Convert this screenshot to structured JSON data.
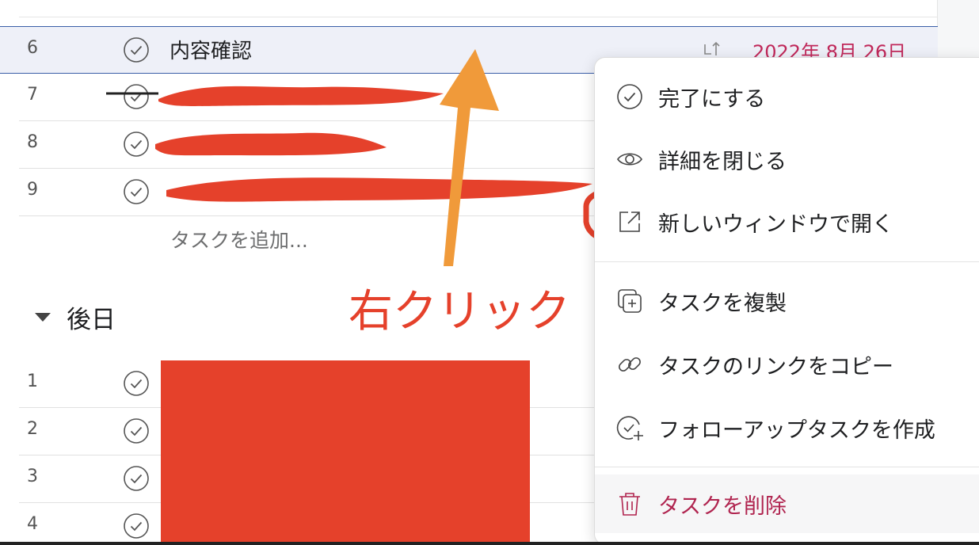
{
  "topsection": {
    "label": ""
  },
  "tasks": [
    {
      "num": "6",
      "title": "内容確認",
      "subtask_icon": "subtask-icon",
      "date": "2022年 8月 26日"
    },
    {
      "num": "7",
      "title": ""
    },
    {
      "num": "8",
      "title": ""
    },
    {
      "num": "9",
      "title": ""
    }
  ],
  "add_task": "タスクを追加...",
  "later_section": {
    "label": "後日"
  },
  "later_tasks": [
    {
      "num": "1"
    },
    {
      "num": "2"
    },
    {
      "num": "3"
    },
    {
      "num": "4"
    }
  ],
  "annotation": "右クリック",
  "context_menu": {
    "items": [
      {
        "label": "完了にする",
        "icon": "check-circle-icon"
      },
      {
        "label": "詳細を閉じる",
        "icon": "eye-icon"
      },
      {
        "label": "新しいウィンドウで開く",
        "icon": "open-new-window-icon"
      },
      {
        "label": "タスクを複製",
        "icon": "duplicate-icon"
      },
      {
        "label": "タスクのリンクをコピー",
        "icon": "link-icon"
      },
      {
        "label": "フォローアップタスクを作成",
        "icon": "follow-up-icon"
      },
      {
        "label": "タスクを削除",
        "icon": "trash-icon"
      }
    ]
  },
  "colors": {
    "accent_red": "#e5412b",
    "danger": "#b0244f",
    "due_date": "#c0285a",
    "annotation_arrow": "#f09a3a",
    "selected_border": "#3a5ea8"
  }
}
